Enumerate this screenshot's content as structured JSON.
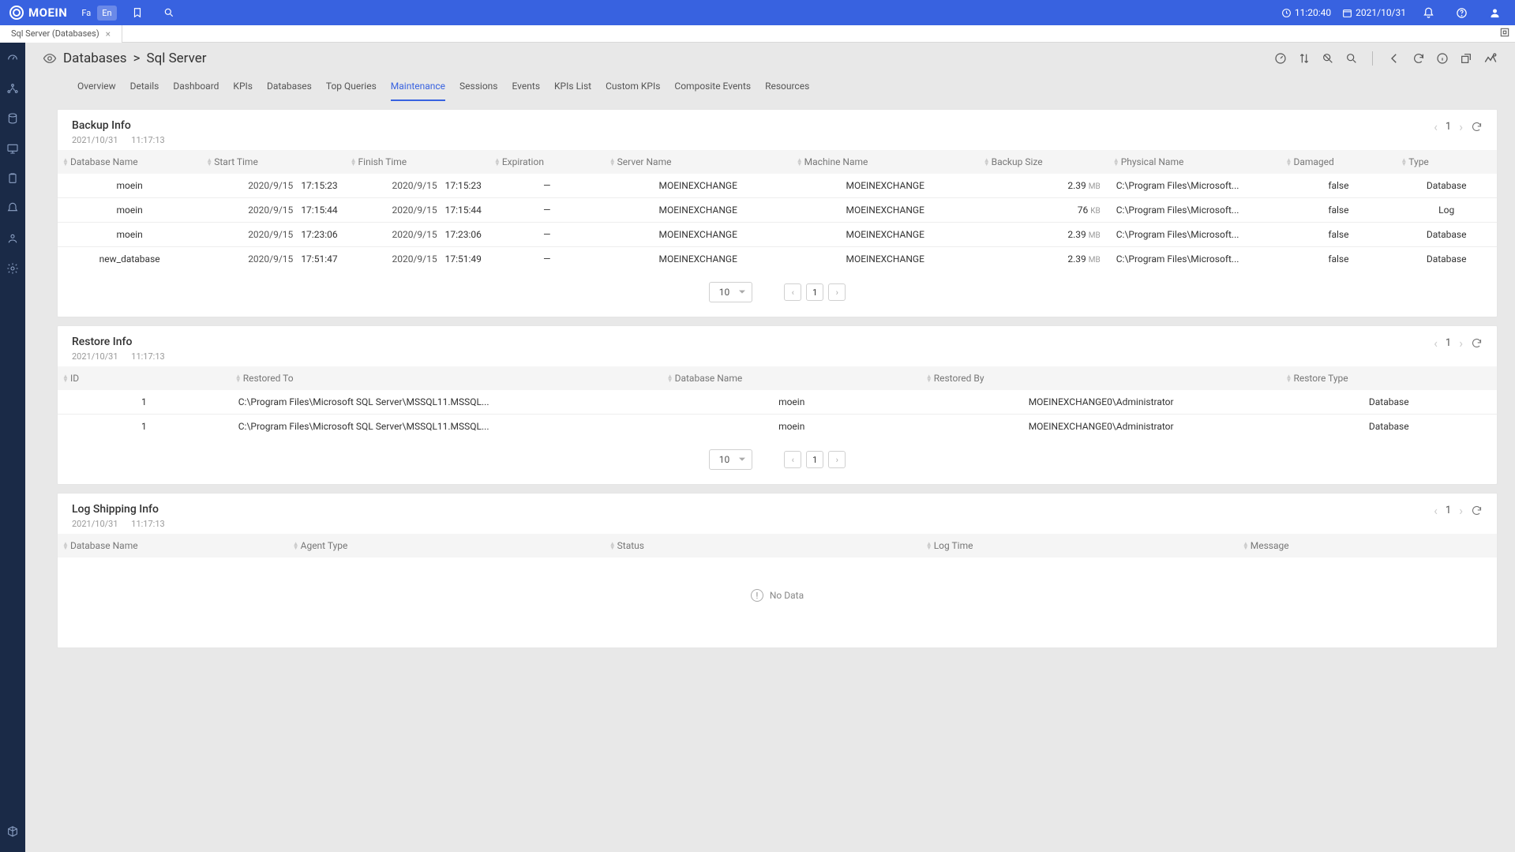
{
  "header": {
    "brand": "MOEIN",
    "lang_fa": "Fa",
    "lang_en": "En",
    "time": "11:20:40",
    "date": "2021/10/31"
  },
  "tab": {
    "title": "Sql Server (Databases)"
  },
  "breadcrumb": {
    "databases": "Databases",
    "sep": ">",
    "sqlserver": "Sql Server"
  },
  "subtabs": [
    "Overview",
    "Details",
    "Dashboard",
    "KPIs",
    "Databases",
    "Top Queries",
    "Maintenance",
    "Sessions",
    "Events",
    "KPIs List",
    "Custom KPIs",
    "Composite Events",
    "Resources"
  ],
  "subtab_active_index": 6,
  "panels": {
    "backup": {
      "title": "Backup Info",
      "date": "2021/10/31",
      "time": "11:17:13",
      "page": "1",
      "pagesize": "10",
      "cols": [
        "Database Name",
        "Start Time",
        "Finish Time",
        "Expiration",
        "Server Name",
        "Machine Name",
        "Backup Size",
        "Physical Name",
        "Damaged",
        "Type"
      ],
      "rows": [
        {
          "db": "moein",
          "sd": "2020/9/15",
          "st": "17:15:23",
          "fd": "2020/9/15",
          "ft": "17:15:23",
          "exp": "—",
          "server": "MOEINEXCHANGE",
          "machine": "MOEINEXCHANGE",
          "size": "2.39",
          "unit": "MB",
          "phys": "C:\\Program Files\\Microsoft...",
          "dmg": "false",
          "type": "Database"
        },
        {
          "db": "moein",
          "sd": "2020/9/15",
          "st": "17:15:44",
          "fd": "2020/9/15",
          "ft": "17:15:44",
          "exp": "—",
          "server": "MOEINEXCHANGE",
          "machine": "MOEINEXCHANGE",
          "size": "76",
          "unit": "KB",
          "phys": "C:\\Program Files\\Microsoft...",
          "dmg": "false",
          "type": "Log"
        },
        {
          "db": "moein",
          "sd": "2020/9/15",
          "st": "17:23:06",
          "fd": "2020/9/15",
          "ft": "17:23:06",
          "exp": "—",
          "server": "MOEINEXCHANGE",
          "machine": "MOEINEXCHANGE",
          "size": "2.39",
          "unit": "MB",
          "phys": "C:\\Program Files\\Microsoft...",
          "dmg": "false",
          "type": "Database"
        },
        {
          "db": "new_database",
          "sd": "2020/9/15",
          "st": "17:51:47",
          "fd": "2020/9/15",
          "ft": "17:51:49",
          "exp": "—",
          "server": "MOEINEXCHANGE",
          "machine": "MOEINEXCHANGE",
          "size": "2.39",
          "unit": "MB",
          "phys": "C:\\Program Files\\Microsoft...",
          "dmg": "false",
          "type": "Database"
        }
      ]
    },
    "restore": {
      "title": "Restore Info",
      "date": "2021/10/31",
      "time": "11:17:13",
      "page": "1",
      "pagesize": "10",
      "cols": [
        "ID",
        "Restored To",
        "Database Name",
        "Restored By",
        "Restore Type"
      ],
      "rows": [
        {
          "id": "1",
          "to": "C:\\Program Files\\Microsoft SQL Server\\MSSQL11.MSSQL...",
          "db": "moein",
          "by": "MOEINEXCHANGE0\\Administrator",
          "type": "Database"
        },
        {
          "id": "1",
          "to": "C:\\Program Files\\Microsoft SQL Server\\MSSQL11.MSSQL...",
          "db": "moein",
          "by": "MOEINEXCHANGE0\\Administrator",
          "type": "Database"
        }
      ]
    },
    "logship": {
      "title": "Log Shipping Info",
      "date": "2021/10/31",
      "time": "11:17:13",
      "page": "1",
      "cols": [
        "Database Name",
        "Agent Type",
        "Status",
        "Log Time",
        "Message"
      ],
      "nodata": "No Data"
    }
  }
}
